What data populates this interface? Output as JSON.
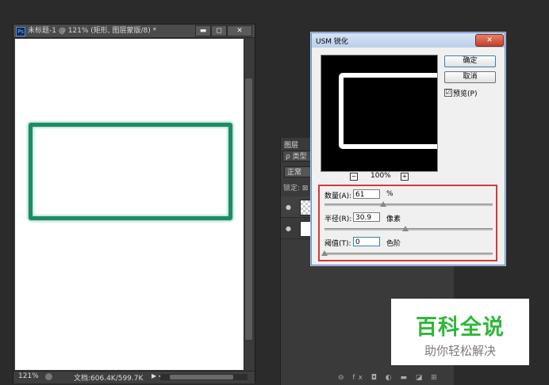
{
  "document": {
    "title": "未标题-1 @ 121% (矩形, 图层蒙版/8) *",
    "ps_badge": "Ps",
    "minimize": "▬",
    "maximize": "◻",
    "close": "✕",
    "zoom": "121%",
    "doc_size": "文档:606.4K/599.7K",
    "play": "▶ ◂"
  },
  "layers_panel": {
    "tab_label": "图层",
    "kind_filter": "ρ 类型",
    "blend_mode": "正常",
    "lock_label": "锁定: ⊠",
    "eye_icon": "●",
    "footer_icons": "⊖ fx ◘ ◐ ▬ ◪ ⊞"
  },
  "dialog": {
    "title": "USM 锐化",
    "close": "✕",
    "ok_label": "确定",
    "cancel_label": "取消",
    "preview_checked": "☑",
    "preview_label": "预览(P)",
    "zoom_out": "−",
    "zoom_in": "+",
    "zoom_percent": "100%",
    "amount": {
      "label": "数量(A):",
      "value": "61",
      "unit": "%",
      "slider": 0.35
    },
    "radius": {
      "label": "半径(R):",
      "value": "30.9",
      "unit": "像素",
      "slider": 0.48
    },
    "threshold": {
      "label": "阈值(T):",
      "value": "0",
      "unit": "色阶",
      "slider": 0.0
    }
  },
  "watermark": {
    "main": "百科全说",
    "sub": "助你轻松解决"
  }
}
